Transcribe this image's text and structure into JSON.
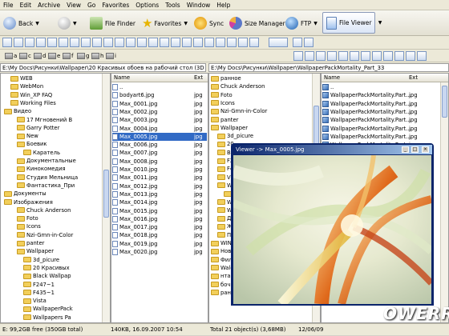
{
  "menu": [
    "File",
    "Edit",
    "Archive",
    "View",
    "Go",
    "Favorites",
    "Options",
    "Tools",
    "Window",
    "Help"
  ],
  "toolbar": {
    "back": "Back",
    "file_finder": "File Finder",
    "favorites": "Favorites",
    "sync": "Sync",
    "size_manager": "Size Manager",
    "ftp": "FTP",
    "file_viewer": "File Viewer"
  },
  "drives": [
    "a",
    "c",
    "d",
    "e",
    "f",
    "g",
    "h",
    "i"
  ],
  "left": {
    "path": "E:\\My Docs\\Рисунки\\Wallpaper\\20 Красивых обоев на рабочий стол (3D графика)",
    "tree": [
      {
        "label": "WEB",
        "indent": 1
      },
      {
        "label": "WebMon",
        "indent": 1
      },
      {
        "label": "Win_XP FAQ",
        "indent": 1
      },
      {
        "label": "Working Files",
        "indent": 1
      },
      {
        "label": "Видео",
        "indent": 0
      },
      {
        "label": "17 Мгновений В",
        "indent": 2
      },
      {
        "label": "Garry Potter",
        "indent": 2
      },
      {
        "label": "New",
        "indent": 2
      },
      {
        "label": "Боевик",
        "indent": 2
      },
      {
        "label": "Каратель",
        "indent": 3
      },
      {
        "label": "Документальные",
        "indent": 2
      },
      {
        "label": "Кинокомедия",
        "indent": 2
      },
      {
        "label": "Студия Мельница",
        "indent": 2
      },
      {
        "label": "Фантастика_При",
        "indent": 2
      },
      {
        "label": "Документы",
        "indent": 0
      },
      {
        "label": "Изображения",
        "indent": 0
      },
      {
        "label": "Chuck Anderson",
        "indent": 2
      },
      {
        "label": "Foto",
        "indent": 2
      },
      {
        "label": "Icons",
        "indent": 2
      },
      {
        "label": "Nzi-Gmn-in-Color",
        "indent": 2
      },
      {
        "label": "panter",
        "indent": 2
      },
      {
        "label": "Wallpaper",
        "indent": 2
      },
      {
        "label": "3d_picure",
        "indent": 3
      },
      {
        "label": "20 Красивых",
        "indent": 3
      },
      {
        "label": "Black Wallpap",
        "indent": 3
      },
      {
        "label": "F247~1",
        "indent": 3
      },
      {
        "label": "F435~1",
        "indent": 3
      },
      {
        "label": "Vista",
        "indent": 3
      },
      {
        "label": "WallpaperPack",
        "indent": 3
      },
      {
        "label": "Wallpapers Pa",
        "indent": 3
      }
    ],
    "files_header": {
      "name": "Name",
      "ext": "Ext"
    },
    "files": [
      {
        "name": "..",
        "ext": ""
      },
      {
        "name": "bodyart6.jpg",
        "ext": "jpg"
      },
      {
        "name": "Max_0001.jpg",
        "ext": "jpg"
      },
      {
        "name": "Max_0002.jpg",
        "ext": "jpg"
      },
      {
        "name": "Max_0003.jpg",
        "ext": "jpg"
      },
      {
        "name": "Max_0004.jpg",
        "ext": "jpg"
      },
      {
        "name": "Max_0005.jpg",
        "ext": "jpg",
        "selected": true
      },
      {
        "name": "Max_0006.jpg",
        "ext": "jpg"
      },
      {
        "name": "Max_0007.jpg",
        "ext": "jpg"
      },
      {
        "name": "Max_0008.jpg",
        "ext": "jpg"
      },
      {
        "name": "Max_0010.jpg",
        "ext": "jpg"
      },
      {
        "name": "Max_0011.jpg",
        "ext": "jpg"
      },
      {
        "name": "Max_0012.jpg",
        "ext": "jpg"
      },
      {
        "name": "Max_0013.jpg",
        "ext": "jpg"
      },
      {
        "name": "Max_0014.jpg",
        "ext": "jpg"
      },
      {
        "name": "Max_0015.jpg",
        "ext": "jpg"
      },
      {
        "name": "Max_0016.jpg",
        "ext": "jpg"
      },
      {
        "name": "Max_0017.jpg",
        "ext": "jpg"
      },
      {
        "name": "Max_0018.jpg",
        "ext": "jpg"
      },
      {
        "name": "Max_0019.jpg",
        "ext": "jpg"
      },
      {
        "name": "Max_0020.jpg",
        "ext": "jpg"
      }
    ]
  },
  "right": {
    "path": "E:\\My Docs\\Рисунки\\Wallpaper\\WallpaperPackMortality_Part_33",
    "tree": [
      {
        "label": "ранное",
        "indent": 0
      },
      {
        "label": "Chuck Anderson",
        "indent": 0
      },
      {
        "label": "Foto",
        "indent": 0
      },
      {
        "label": "Icons",
        "indent": 0
      },
      {
        "label": "Nzi-Gmn-in-Color",
        "indent": 0
      },
      {
        "label": "panter",
        "indent": 0
      },
      {
        "label": "Wallpaper",
        "indent": 0
      },
      {
        "label": "3d_picure",
        "indent": 1
      },
      {
        "label": "20",
        "indent": 1
      },
      {
        "label": "Black",
        "indent": 1
      },
      {
        "label": "F247",
        "indent": 1
      },
      {
        "label": "F435",
        "indent": 1
      },
      {
        "label": "Vista",
        "indent": 1
      },
      {
        "label": "Wa",
        "indent": 1
      },
      {
        "label": "Wa",
        "indent": 2
      },
      {
        "label": "Wallp",
        "indent": 1
      },
      {
        "label": "WINX",
        "indent": 1
      },
      {
        "label": "Девуш",
        "indent": 1
      },
      {
        "label": "Жени",
        "indent": 1
      },
      {
        "label": "Приро",
        "indent": 1
      },
      {
        "label": "WIN",
        "indent": 0
      },
      {
        "label": "Новая п",
        "indent": 0
      },
      {
        "label": "Фильм",
        "indent": 0
      },
      {
        "label": "Waldemar",
        "indent": 0
      },
      {
        "label": "нтакты",
        "indent": 0
      },
      {
        "label": "бочий стол",
        "indent": 0
      },
      {
        "label": "ранное",
        "indent": 0
      }
    ],
    "files_header": {
      "name": "Name",
      "ext": "Ext"
    },
    "files": [
      {
        "name": "..",
        "ext": ""
      },
      {
        "name": "WallpaperPackMortality.Part...",
        "ext": "jpg"
      },
      {
        "name": "WallpaperPackMortality.Part...",
        "ext": "jpg"
      },
      {
        "name": "WallpaperPackMortality.Part...",
        "ext": "jpg"
      },
      {
        "name": "WallpaperPackMortality.Part...",
        "ext": "jpg"
      },
      {
        "name": "WallpaperPackMortality.Part...",
        "ext": "jpg"
      },
      {
        "name": "WallpaperPackMortality.Part...",
        "ext": "jpg"
      },
      {
        "name": "WallpaperPackMortality.Part...",
        "ext": "jpg"
      }
    ]
  },
  "viewer": {
    "title": "Viewer -> Max_0005.jpg"
  },
  "status": {
    "free": "E: 99,2GB free (350GB total)",
    "size_date": "140KB, 16.09.2007 10:54",
    "total": "Total 21 object(s) (3,68MB)",
    "right_date": "12/06/09"
  },
  "watermark": "OWERRU"
}
